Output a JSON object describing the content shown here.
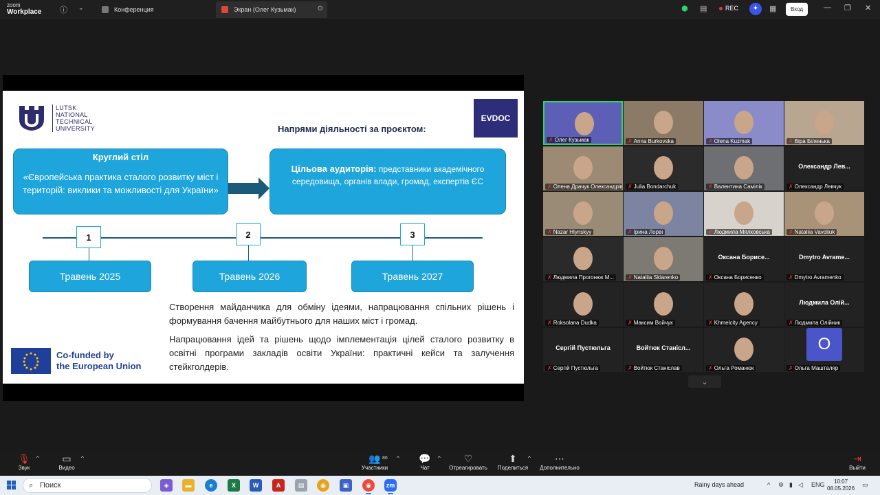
{
  "titlebar": {
    "logo_line1": "zoom",
    "logo_line2": "Workplace",
    "tabs": [
      {
        "label": "Конференция"
      },
      {
        "label": "Экран (Олег Кузьмак)"
      }
    ],
    "rec_label": "REC",
    "login_label": "Вход"
  },
  "slide": {
    "lntu_text": [
      "LUTSK",
      "NATIONAL",
      "TECHNICAL",
      "UNIVERSITY"
    ],
    "evdoc": "EVDOC",
    "title": "Напрями діяльності за проєктом:",
    "box1_title": "Круглий стіл",
    "box1_body": "«Європейська практика сталого розвитку міст і територій: виклики та можливості для України»",
    "box2_bold": "Цільова аудиторія:",
    "box2_body": " представники академічного середовища, органів влади, громад, експертів ЄС",
    "steps": [
      {
        "num": "1",
        "date": "Травень 2025"
      },
      {
        "num": "2",
        "date": "Травень 2026"
      },
      {
        "num": "3",
        "date": "Травень 2027"
      }
    ],
    "para1": "Створення майданчика для обміну ідеями, напрацювання спільних рішень і формування бачення майбутнього для наших міст і громад.",
    "para2": "Напрацювання ідей та рішень щодо імплементація цілей сталого розвитку в освітні програми закладів освіти України: практичні кейси та залучення стейкголдерів.",
    "eu_line1": "Co-funded by",
    "eu_line2": "the European Union"
  },
  "gallery": {
    "participants": [
      {
        "name": "Олег Кузьмак",
        "display": "",
        "video": true,
        "active": true,
        "bg": "#5d5fb7"
      },
      {
        "name": "Anna Burkovska",
        "display": "",
        "video": true,
        "bg": "#8b7a66"
      },
      {
        "name": "Olena Kuzmak",
        "display": "",
        "video": true,
        "bg": "#8a8cc9"
      },
      {
        "name": "Віра Біленька",
        "display": "",
        "video": true,
        "bg": "#b9a690"
      },
      {
        "name": "Олена Драчук Олександрівна",
        "display": "",
        "video": true,
        "bg": "#9c8a74"
      },
      {
        "name": "Julia Bondarchuk",
        "display": "",
        "video": true,
        "bg": "#2b2b2b"
      },
      {
        "name": "Валентина Самілік",
        "display": "",
        "video": true,
        "bg": "#6d6f72"
      },
      {
        "name": "Олександр Левчук",
        "display": "Олександр Лев...",
        "video": false
      },
      {
        "name": "Nazar Hlynskyy",
        "display": "",
        "video": true,
        "bg": "#9a8b76"
      },
      {
        "name": "Ірина Лорві",
        "display": "",
        "video": true,
        "bg": "#7c84a2"
      },
      {
        "name": "Людмила Мялковська",
        "display": "",
        "video": true,
        "bg": "#d7d2cc"
      },
      {
        "name": "Nataliia Vavdiiuk",
        "display": "",
        "video": true,
        "bg": "#a89378"
      },
      {
        "name": "Людмила Прогонюк М...",
        "display": "",
        "video": true,
        "bg": "#2a2a2a"
      },
      {
        "name": "Nataliia Sklarenko",
        "display": "",
        "video": true,
        "bg": "#7d7a74"
      },
      {
        "name": "Оксана Борисенко",
        "display": "Оксана Борисе...",
        "video": false
      },
      {
        "name": "Dmytro Avramenko",
        "display": "Dmytro Avrame...",
        "video": false
      },
      {
        "name": "Roksolana Dudka",
        "display": "",
        "video": true,
        "bg": "#232323"
      },
      {
        "name": "Максим Войчук",
        "display": "",
        "video": true,
        "bg": "#232323"
      },
      {
        "name": "Khmelcity Agency",
        "display": "",
        "video": true,
        "bg": "#232323"
      },
      {
        "name": "Людмила Олійник",
        "display": "Людмила Олій...",
        "video": false
      },
      {
        "name": "Сергій Пустюльга",
        "display": "Сергій Пустюльга",
        "video": false
      },
      {
        "name": "Войтюк Станіслав",
        "display": "Войтюк Станісл...",
        "video": false
      },
      {
        "name": "Ольга Романюк",
        "display": "",
        "video": true,
        "bg": "#232323"
      },
      {
        "name": "Ольга Машталяр",
        "display": "O",
        "video": false,
        "avatar": true
      }
    ]
  },
  "toolbar": {
    "audio": "Звук",
    "video": "Видео",
    "participants": "Участники",
    "participants_count": "86",
    "chat": "Чат",
    "react": "Отреагировать",
    "share": "Поделиться",
    "more": "Дополнительно",
    "leave": "Выйти"
  },
  "taskbar": {
    "search_placeholder": "Поиск",
    "weather": "Rainy days ahead",
    "lang": "ENG",
    "time": "10:07",
    "date": "08.05.2026"
  }
}
